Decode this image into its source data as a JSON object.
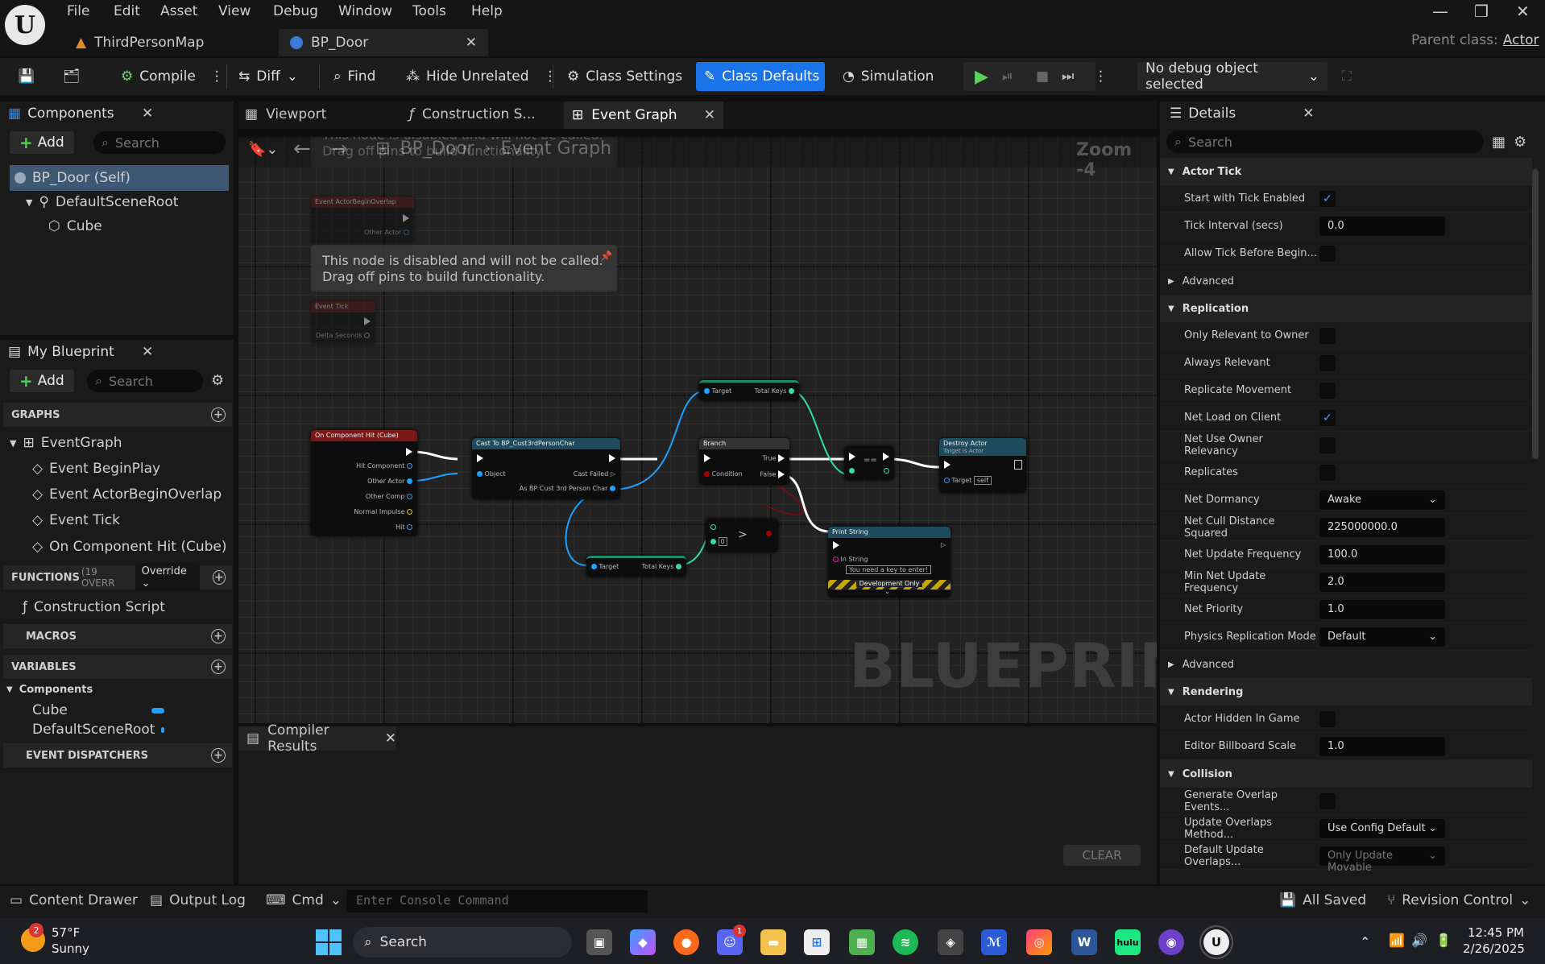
{
  "app": {
    "logo": "U",
    "parent_class_label": "Parent class:",
    "parent_class_value": "Actor"
  },
  "menu": [
    "File",
    "Edit",
    "Asset",
    "View",
    "Debug",
    "Window",
    "Tools",
    "Help"
  ],
  "doc_tabs": [
    {
      "label": "ThirdPersonMap",
      "icon": "level-icon"
    },
    {
      "label": "BP_Door",
      "icon": "blueprint-icon"
    }
  ],
  "window_controls": {
    "minimize": "—",
    "restore": "❐",
    "close": "✕"
  },
  "toolbar": {
    "compile": "Compile",
    "diff": "Diff",
    "find": "Find",
    "hide_unrelated": "Hide Unrelated",
    "class_settings": "Class Settings",
    "class_defaults": "Class Defaults",
    "simulation": "Simulation",
    "debug_object": "No debug object selected"
  },
  "components": {
    "title": "Components",
    "add": "Add",
    "search_placeholder": "Search",
    "tree": [
      "BP_Door (Self)",
      "DefaultSceneRoot",
      "Cube"
    ]
  },
  "my_blueprint": {
    "title": "My Blueprint",
    "add": "Add",
    "search_placeholder": "Search",
    "graphs_label": "GRAPHS",
    "event_graph": "EventGraph",
    "events": [
      "Event BeginPlay",
      "Event ActorBeginOverlap",
      "Event Tick",
      "On Component Hit (Cube)"
    ],
    "functions_label": "FUNCTIONS",
    "functions_count": "(19 OVERR",
    "override": "Override",
    "construction_script": "Construction Script",
    "macros_label": "MACROS",
    "variables_label": "VARIABLES",
    "components_group": "Components",
    "variables": [
      "Cube",
      "DefaultSceneRoot"
    ],
    "dispatchers_label": "EVENT DISPATCHERS"
  },
  "graph_tabs": [
    "Viewport",
    "Construction S...",
    "Event Graph"
  ],
  "graph": {
    "breadcrumb_root": "BP_Door",
    "breadcrumb_page": "Event Graph",
    "zoom": "Zoom -4",
    "watermark": "BLUEPRINT",
    "disabled_tip_line1": "This node is disabled and will not be called.",
    "disabled_tip_line2": "Drag off pins to build functionality.",
    "nodes": {
      "begin_overlap": "Event ActorBeginOverlap",
      "other_actor": "Other Actor",
      "event_tick": "Event Tick",
      "delta_seconds": "Delta Seconds",
      "on_hit": "On Component Hit (Cube)",
      "hit_component": "Hit Component",
      "on_hit_other_actor": "Other Actor",
      "other_comp": "Other Comp",
      "normal_impulse": "Normal Impulse",
      "hit": "Hit",
      "cast": "Cast To BP_Cust3rdPersonChar",
      "object": "Object",
      "cast_failed": "Cast Failed",
      "as_char": "As BP Cust 3rd Person Char",
      "target": "Target",
      "total_keys": "Total Keys",
      "target2": "Target",
      "total_keys2": "Total Keys",
      "branch": "Branch",
      "true": "True",
      "false": "False",
      "condition": "Condition",
      "gt": ">",
      "zero": "0",
      "eq": "==",
      "destroy": "Destroy Actor",
      "destroy_sub": "Target is Actor",
      "destroy_target": "Target",
      "self": "self",
      "print": "Print String",
      "in_string": "In String",
      "in_string_val": "You need a key to enter!",
      "dev_only": "Development Only"
    }
  },
  "compiler": {
    "title": "Compiler Results",
    "clear": "CLEAR"
  },
  "details": {
    "title": "Details",
    "search_placeholder": "Search",
    "actor_tick": "Actor Tick",
    "start_tick": "Start with Tick Enabled",
    "tick_interval": "Tick Interval (secs)",
    "tick_interval_val": "0.0",
    "allow_tick": "Allow Tick Before Begin...",
    "advanced": "Advanced",
    "replication": "Replication",
    "only_relevant": "Only Relevant to Owner",
    "always_relevant": "Always Relevant",
    "replicate_movement": "Replicate Movement",
    "net_load": "Net Load on Client",
    "net_use_owner": "Net Use Owner Relevancy",
    "replicates": "Replicates",
    "net_dormancy": "Net Dormancy",
    "net_dormancy_val": "Awake",
    "net_cull": "Net Cull Distance Squared",
    "net_cull_val": "225000000.0",
    "net_update": "Net Update Frequency",
    "net_update_val": "100.0",
    "min_net_update": "Min Net Update Frequency",
    "min_net_update_val": "2.0",
    "net_priority": "Net Priority",
    "net_priority_val": "1.0",
    "physics_rep": "Physics Replication Mode",
    "physics_rep_val": "Default",
    "advanced2": "Advanced",
    "rendering": "Rendering",
    "hidden_in_game": "Actor Hidden In Game",
    "billboard": "Editor Billboard Scale",
    "billboard_val": "1.0",
    "collision": "Collision",
    "gen_overlap": "Generate Overlap Events...",
    "update_overlaps": "Update Overlaps Method...",
    "update_overlaps_val": "Use Config Default",
    "default_update": "Default Update Overlaps...",
    "default_update_val": "Only Update Movable"
  },
  "statusbar": {
    "content_drawer": "Content Drawer",
    "output_log": "Output Log",
    "cmd": "Cmd",
    "console_placeholder": "Enter Console Command",
    "all_saved": "All Saved",
    "revision_control": "Revision Control"
  },
  "taskbar": {
    "weather_badge": "2",
    "temp": "57°F",
    "condition": "Sunny",
    "search": "Search",
    "discord_badge": "1",
    "hulu": "hulu",
    "time": "12:45 PM",
    "date": "2/26/2025"
  },
  "colors": {
    "accent": "#1a73e8",
    "exec": "#ffffff",
    "object_pin": "#1ca1ff",
    "int_pin": "#2ee0a4",
    "bool_pin": "#a80000",
    "string_pin": "#ff00d4",
    "event_header": "#7a1818",
    "function_header": "#1f4b5e"
  }
}
